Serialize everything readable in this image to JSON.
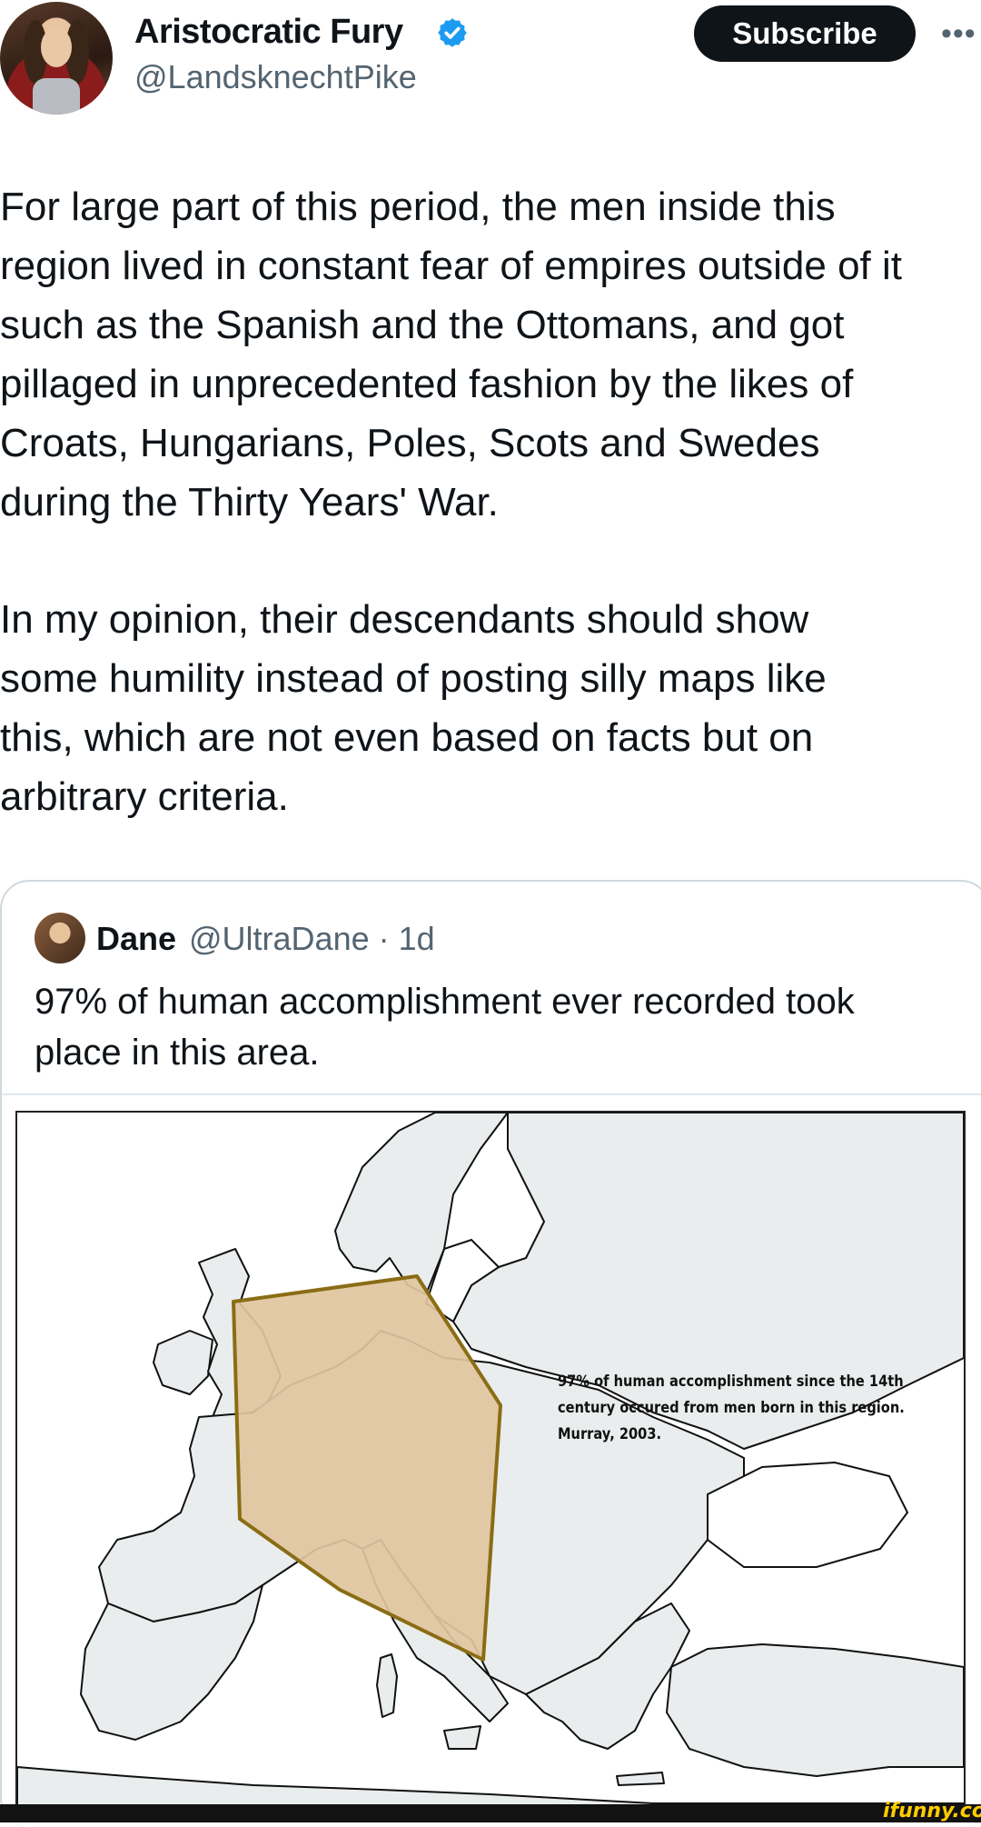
{
  "tweet": {
    "display_name": "Aristocratic Fury",
    "handle": "@LandsknechtPike",
    "subscribe_label": "Subscribe",
    "more_label": "•••",
    "paragraphs": [
      "For large part of this period, the men inside this\nregion lived in constant fear of empires outside of it\nsuch as the Spanish and the Ottomans, and got\npillaged in unprecedented fashion by the likes of\nCroats, Hungarians, Poles, Scots and Swedes\nduring the Thirty Years' War.",
      "In my opinion, their descendants should show\nsome humility instead of posting silly maps like\nthis, which are not even based on facts but on\narbitrary criteria."
    ]
  },
  "quote": {
    "name": "Dane",
    "handle_time": "@UltraDane · 1d",
    "text": "97% of human accomplishment ever recorded took\nplace in this area."
  },
  "map": {
    "caption_lines": [
      "97% of human accomplishment since the 14th",
      "century occured from men born in this region.",
      "Murray, 2003."
    ],
    "region_fill": "#dfc6a0",
    "region_stroke": "#8a6d14"
  },
  "watermark": "ifunny.co",
  "colors": {
    "text": "#0f1419",
    "secondary": "#536471",
    "verified": "#1d9bf0"
  }
}
